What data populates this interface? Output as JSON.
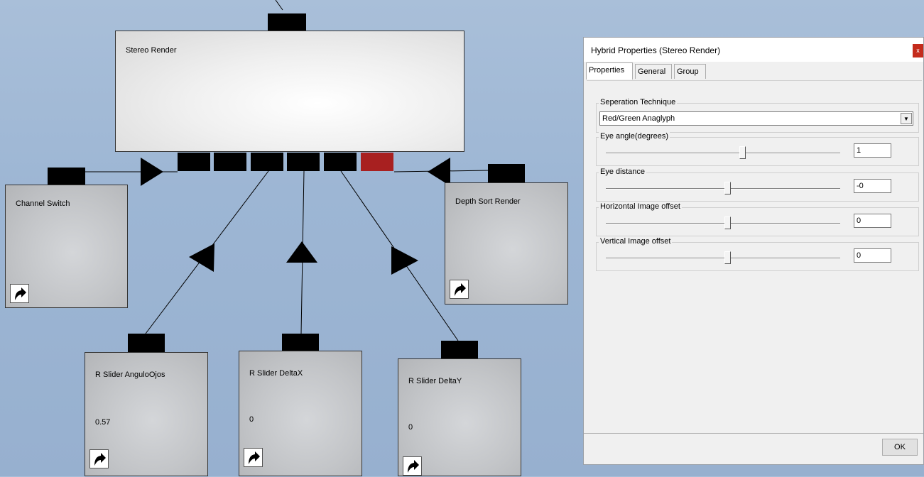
{
  "graph": {
    "nodes": {
      "stereo_render": {
        "title": "Stereo Render"
      },
      "channel_switch": {
        "title": "Channel Switch"
      },
      "depth_sort_render": {
        "title": "Depth Sort Render"
      },
      "slider_angulo": {
        "title": "R Slider  AnguloOjos",
        "value": "0.57"
      },
      "slider_deltax": {
        "title": "R Slider  DeltaX",
        "value": "0"
      },
      "slider_deltay": {
        "title": "R Slider  DeltaY",
        "value": "0"
      }
    },
    "colors": {
      "port": "#000000",
      "active_port": "#a82020"
    }
  },
  "dialog": {
    "title": "Hybrid Properties (Stereo Render)",
    "close_label": "x",
    "tabs": [
      "Properties",
      "General",
      "Group"
    ],
    "active_tab": "Properties",
    "separation": {
      "label": "Seperation Technique",
      "value": "Red/Green Anaglyph"
    },
    "eye_angle": {
      "label": "Eye angle(degrees)",
      "value": "1",
      "slider_fraction": 0.58
    },
    "eye_distance": {
      "label": "Eye distance",
      "value": "-0",
      "slider_fraction": 0.5
    },
    "horizontal_offset": {
      "label": "Horizontal Image offset",
      "value": "0",
      "slider_fraction": 0.5
    },
    "vertical_offset": {
      "label": "Vertical Image offset",
      "value": "0",
      "slider_fraction": 0.5
    },
    "ok_label": "OK"
  }
}
